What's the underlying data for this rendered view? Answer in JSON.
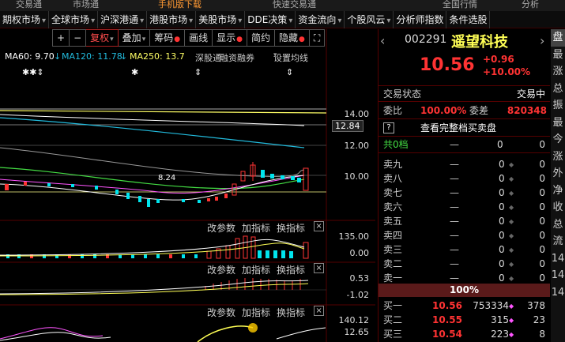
{
  "top_strip": [
    "交易通",
    "市场通",
    "手机版下载",
    "快速交易通",
    "全国行情",
    "分析"
  ],
  "menu": [
    {
      "label": "期权市场",
      "arrow": true
    },
    {
      "label": "全球市场",
      "arrow": true
    },
    {
      "label": "沪深港通",
      "arrow": true
    },
    {
      "label": "港股市场",
      "arrow": true
    },
    {
      "label": "美股市场",
      "arrow": true
    },
    {
      "label": "DDE决策",
      "arrow": true
    },
    {
      "label": "资金流向",
      "arrow": true
    },
    {
      "label": "个股风云",
      "arrow": true
    },
    {
      "label": "分析师指数",
      "arrow": false
    },
    {
      "label": "条件选股",
      "arrow": false
    }
  ],
  "toolbar": {
    "plus": "+",
    "minus": "−",
    "fuquan": "复权",
    "overlay": "叠加",
    "chips": "筹码",
    "draw": "画线",
    "display": "显示",
    "simple": "简约",
    "hide": "隐藏",
    "fullscreen": "⛶"
  },
  "ma": {
    "ma60": "MA60: 9.70",
    "ma120": "MA120: 11.78",
    "ma250": "MA250: 13.7",
    "tab1": "深股通",
    "tab2": "融资融券",
    "tab3": "设置均线"
  },
  "markers": [
    "✱✱⇕",
    "✱",
    "⇕",
    "⇕"
  ],
  "price_axis": [
    "14.00",
    "12.00",
    "10.00"
  ],
  "current_price_tag": "12.84",
  "candle_low_label": "8.24",
  "sub1": {
    "params": "改参数",
    "add": "加指标",
    "switch": "换指标",
    "close": "×",
    "axis": [
      "135.00",
      "0.00"
    ]
  },
  "sub2": {
    "params": "改参数",
    "add": "加指标",
    "switch": "换指标",
    "close": "×",
    "axis": [
      "0.53",
      "-1.02"
    ]
  },
  "sub3": {
    "params": "改参数",
    "add": "加指标",
    "switch": "换指标",
    "close": "×",
    "axis": [
      "140.12",
      "12.65"
    ]
  },
  "stock": {
    "code": "002291",
    "name": "遥望科技",
    "price": "10.56",
    "change": "+0.96",
    "change_pct": "+10.00%",
    "nav_left": "‹",
    "nav_right": "›"
  },
  "status": {
    "label": "交易状态",
    "value": "交易中"
  },
  "ratio": {
    "label1": "委比",
    "value1": "100.00%",
    "label2": "委差",
    "value2": "820348"
  },
  "full_quote": {
    "icon": "?",
    "label": "查看完整档买卖盘"
  },
  "total": {
    "label": "共0档",
    "dash": "—",
    "v1": "0",
    "v2": "0"
  },
  "asks": [
    {
      "label": "卖九",
      "price": "—",
      "vol": "0",
      "n": "0"
    },
    {
      "label": "卖八",
      "price": "—",
      "vol": "0",
      "n": "0"
    },
    {
      "label": "卖七",
      "price": "—",
      "vol": "0",
      "n": "0"
    },
    {
      "label": "卖六",
      "price": "—",
      "vol": "0",
      "n": "0"
    },
    {
      "label": "卖五",
      "price": "—",
      "vol": "0",
      "n": "0"
    },
    {
      "label": "卖四",
      "price": "—",
      "vol": "0",
      "n": "0"
    },
    {
      "label": "卖三",
      "price": "—",
      "vol": "0",
      "n": "0"
    },
    {
      "label": "卖二",
      "price": "—",
      "vol": "0",
      "n": "0"
    },
    {
      "label": "卖一",
      "price": "—",
      "vol": "0",
      "n": "0"
    }
  ],
  "bid_pct": "100%",
  "bids": [
    {
      "label": "买一",
      "price": "10.56",
      "vol": "753334",
      "n": "378"
    },
    {
      "label": "买二",
      "price": "10.55",
      "vol": "315",
      "n": "23"
    },
    {
      "label": "买三",
      "price": "10.54",
      "vol": "223",
      "n": "8"
    }
  ],
  "side_tabs": [
    "盘",
    "最",
    "涨",
    "总",
    "振",
    "最",
    "今",
    "涨",
    "外",
    "净",
    "收",
    "总",
    "流",
    "14",
    "14",
    "14"
  ],
  "colors": {
    "up": "#ff3333",
    "down": "#00e5ee",
    "yellow": "#ffff55",
    "accent": "#ff4d4d"
  }
}
